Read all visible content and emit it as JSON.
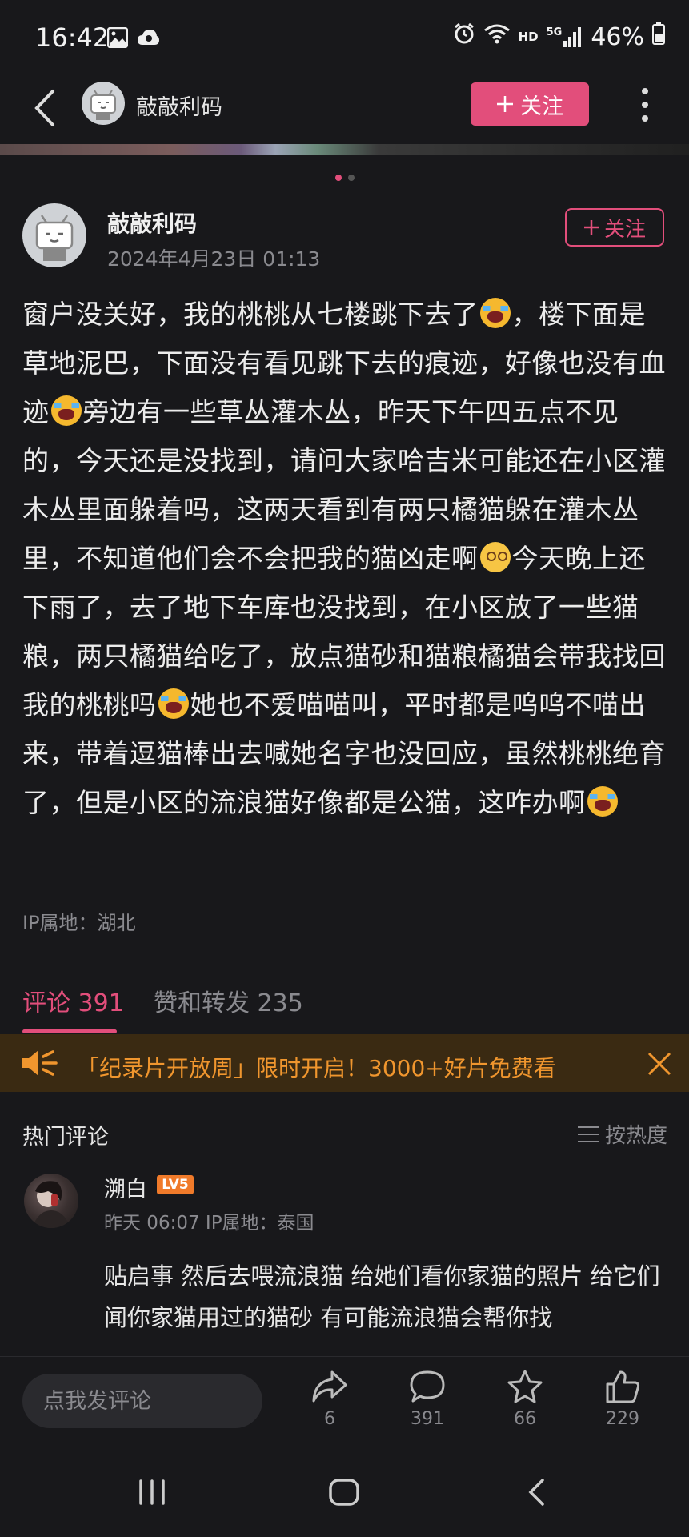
{
  "status_bar": {
    "time": "16:42",
    "battery": "46%",
    "net_hd": "HD",
    "net_5g": "5G"
  },
  "top_bar": {
    "name": "敲敲利码",
    "follow_label": "关注"
  },
  "post": {
    "author": "敲敲利码",
    "date": "2024年4月23日 01:13",
    "follow_label": "关注",
    "text_segments": [
      "窗户没关好，我的桃桃从七楼跳下去了",
      "，楼下面是草地泥巴，下面没有看见跳下去的痕迹，好像也没有血迹",
      "旁边有一些草丛灌木丛，昨天下午四五点不见的，今天还是没找到，请问大家哈吉米可能还在小区灌木丛里面躲着吗，这两天看到有两只橘猫躲在灌木丛里，不知道他们会不会把我的猫凶走啊",
      "今天晚上还下雨了，去了地下车库也没找到，在小区放了一些猫粮，两只橘猫给吃了，放点猫砂和猫粮橘猫会带我找回我的桃桃吗",
      "她也不爱喵喵叫，平时都是呜呜不喵出来，带着逗猫棒出去喊她名字也没回应，虽然桃桃绝育了，但是小区的流浪猫好像都是公猫，这咋办啊"
    ],
    "ip": "IP属地：湖北"
  },
  "tabs": {
    "comments": "评论 391",
    "likes_shares": "赞和转发 235"
  },
  "banner": {
    "text": "「纪录片开放周」限时开启！3000+好片免费看"
  },
  "hot": {
    "title": "热门评论",
    "sort_label": "按热度"
  },
  "comment": {
    "name": "溯白",
    "level": "LV5",
    "meta": "昨天 06:07  IP属地：泰国",
    "text": "贴启事 然后去喂流浪猫 给她们看你家猫的照片 给它们闻你家猫用过的猫砂 有可能流浪猫会帮你找"
  },
  "bottom": {
    "input_placeholder": "点我发评论",
    "share_count": "6",
    "comment_count": "391",
    "fav_count": "66",
    "like_count": "229"
  },
  "colors": {
    "accent": "#e24e7b",
    "banner_text": "#f0962e",
    "background": "#18181b"
  }
}
